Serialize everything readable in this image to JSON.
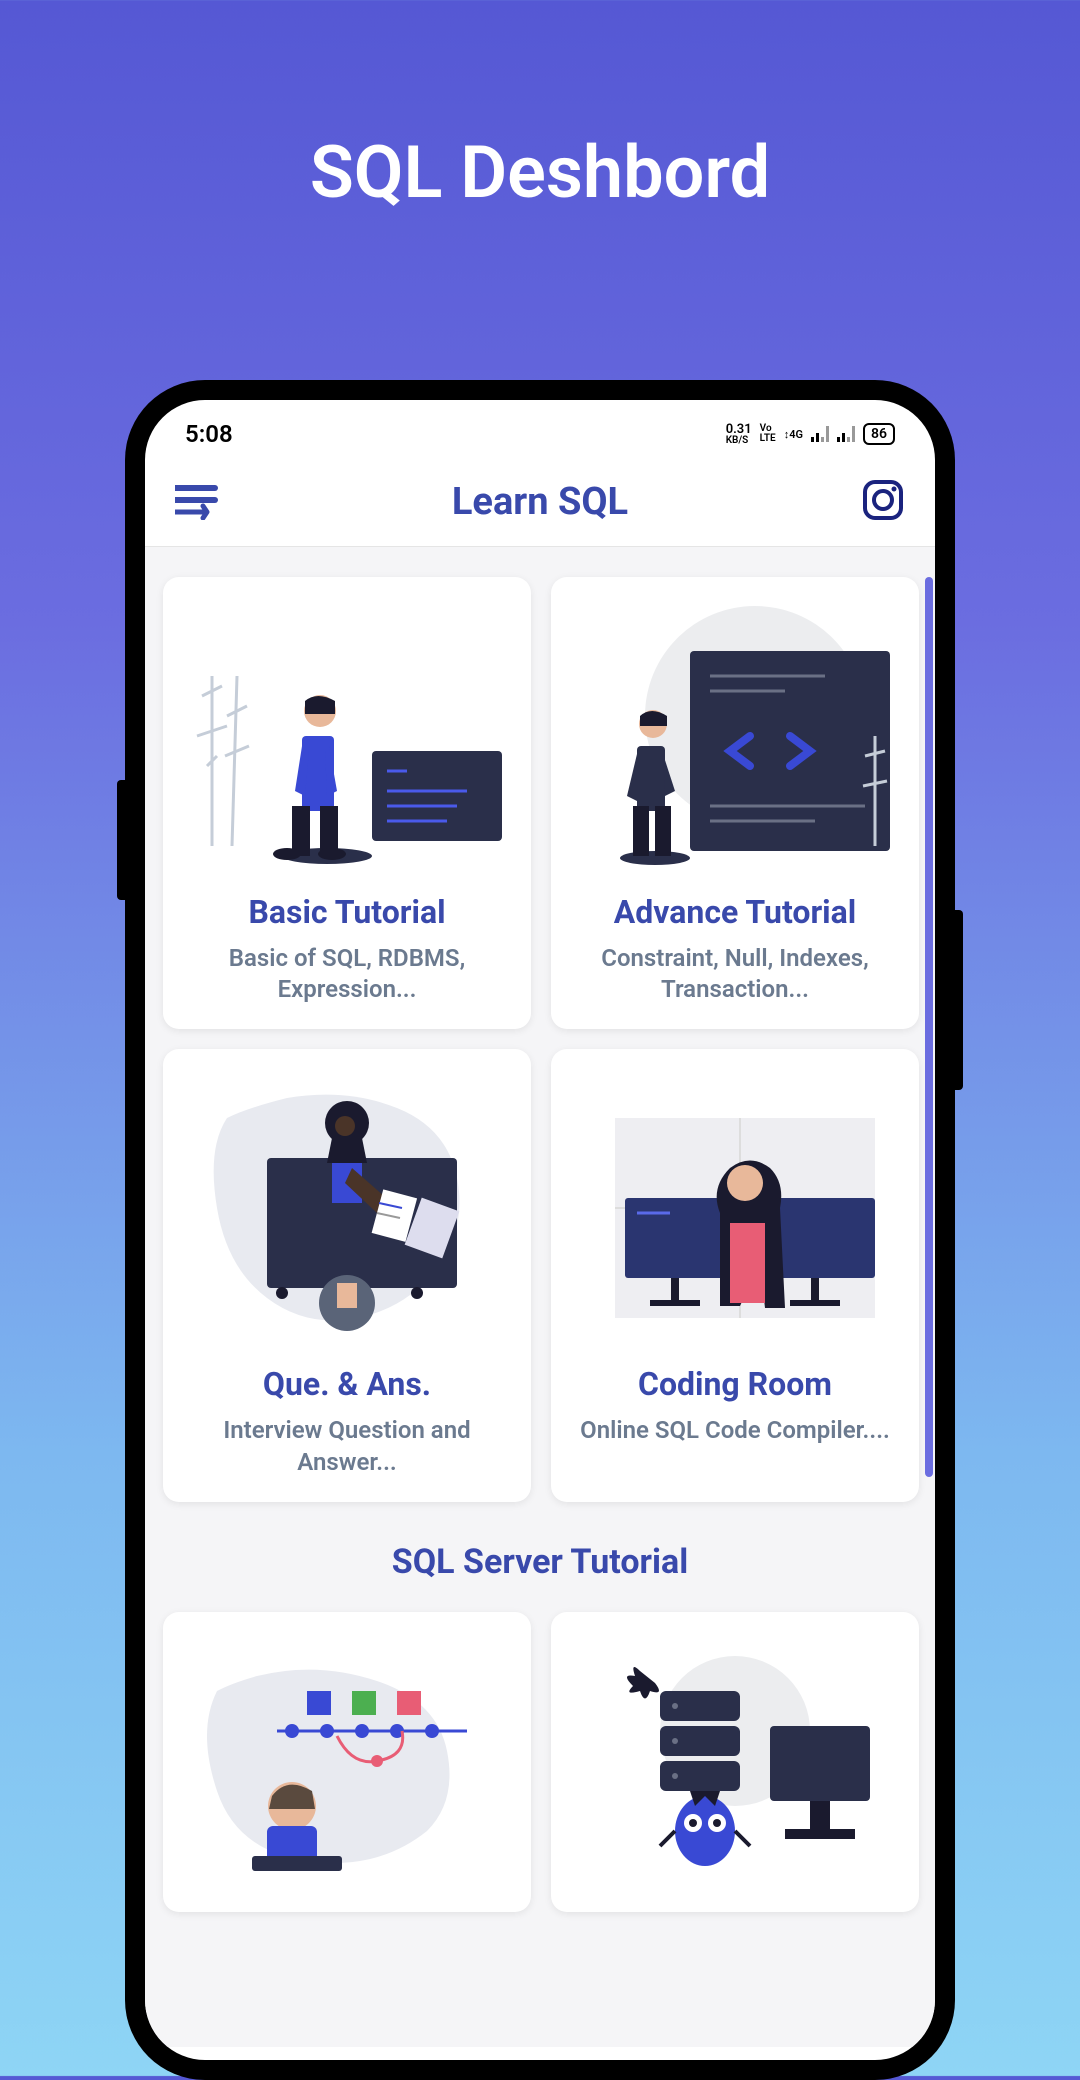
{
  "page": {
    "title": "SQL Deshbord"
  },
  "statusBar": {
    "time": "5:08",
    "dataSpeed": "0.31",
    "dataUnit": "KB/S",
    "volte": "VoLTE",
    "network": "4G",
    "battery": "86"
  },
  "header": {
    "title": "Learn SQL"
  },
  "cards": [
    {
      "title": "Basic Tutorial",
      "subtitle": "Basic of SQL, RDBMS, Expression..."
    },
    {
      "title": "Advance Tutorial",
      "subtitle": "Constraint, Null, Indexes, Transaction..."
    },
    {
      "title": "Que. & Ans.",
      "subtitle": "Interview Question and Answer..."
    },
    {
      "title": "Coding Room",
      "subtitle": "Online SQL Code Compiler...."
    }
  ],
  "section": {
    "title": "SQL Server Tutorial"
  }
}
